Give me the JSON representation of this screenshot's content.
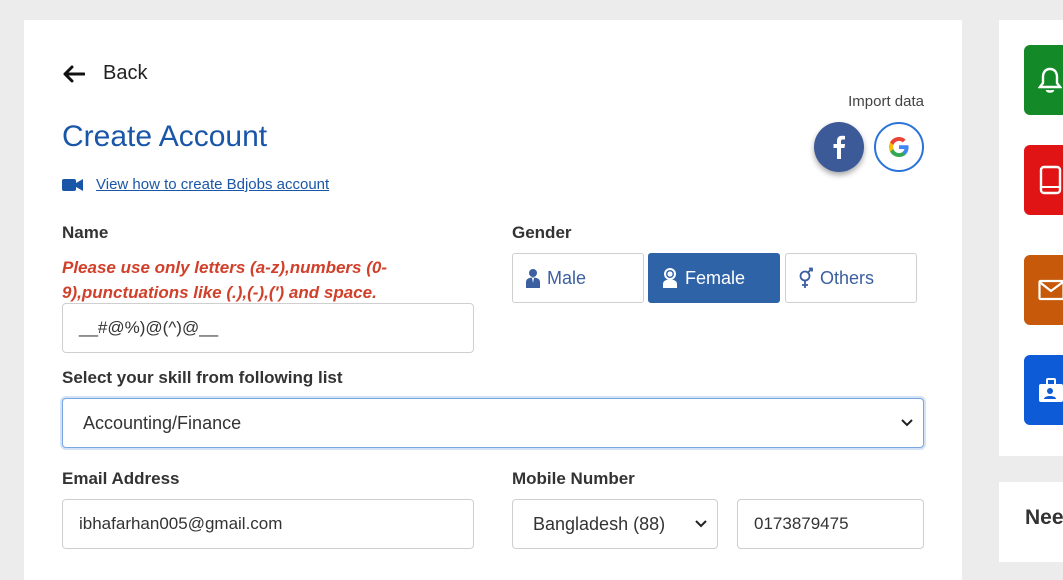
{
  "header": {
    "back_label": "Back"
  },
  "page": {
    "title": "Create Account",
    "video_link": "View how to create Bdjobs account",
    "import_label": "Import data"
  },
  "form": {
    "name": {
      "label": "Name",
      "error": "Please use only letters (a-z),numbers (0-9),punctuations like (.),(-),(') and space.",
      "value": "__#@%)@(^)@__"
    },
    "gender": {
      "label": "Gender",
      "options": [
        {
          "label": "Male",
          "icon": "male-icon"
        },
        {
          "label": "Female",
          "icon": "female-icon"
        },
        {
          "label": "Others",
          "icon": "others-gender-icon"
        }
      ],
      "selected": "Female"
    },
    "skill": {
      "label": "Select your skill from following list",
      "value": "Accounting/Finance"
    },
    "email": {
      "label": "Email Address",
      "value": "ibhafarhan005@gmail.com"
    },
    "mobile": {
      "label": "Mobile Number",
      "country": "Bangladesh (88)",
      "number": "0173879475"
    }
  },
  "sidebar": {
    "buttons": [
      {
        "icon": "bell-icon",
        "color": "#138a27"
      },
      {
        "icon": "tablet-icon",
        "color": "#e01414"
      },
      {
        "icon": "mail-icon",
        "color": "#c65a0a"
      },
      {
        "icon": "id-card-icon",
        "color": "#0d5bd6"
      }
    ],
    "need_heading": "Nee"
  },
  "colors": {
    "accent": "#1a56a8",
    "selected": "#2f63a8",
    "error": "#d0402a"
  }
}
